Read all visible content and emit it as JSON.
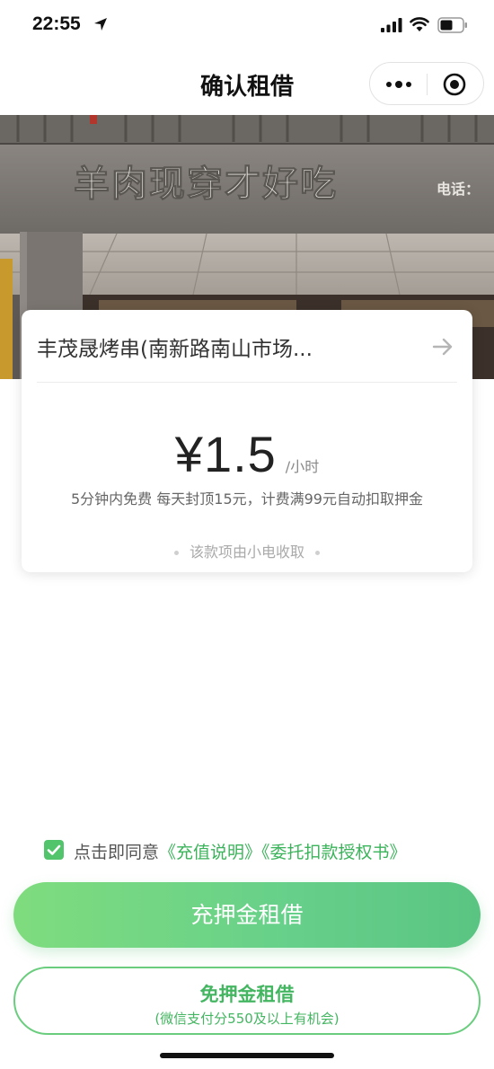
{
  "status_bar": {
    "time": "22:55",
    "icons": [
      "location-arrow-icon",
      "signal-icon",
      "wifi-icon",
      "battery-icon"
    ]
  },
  "nav": {
    "title": "确认租借",
    "capsule_icons": [
      "more-icon",
      "target-icon"
    ]
  },
  "store_photo": {
    "sign_text": "羊肉现穿才好吃",
    "phone_label": "电话："
  },
  "card": {
    "shop_name": "丰茂晟烤串(南新路南山市场...",
    "price": "¥1.5",
    "unit": "/小时",
    "rule": "5分钟内免费 每天封顶15元，计费满99元自动扣取押金",
    "collect_note": "该款项由小电收取"
  },
  "agreement": {
    "prefix": "点击即同意",
    "link1": "《充值说明》",
    "link2": "《委托扣款授权书》",
    "checked": true
  },
  "buttons": {
    "deposit_rent": "充押金租借",
    "free_deposit_rent": "免押金租借",
    "free_deposit_note": "(微信支付分550及以上有机会)"
  },
  "colors": {
    "accent_green": "#52c46b",
    "link_green": "#3bb35a"
  }
}
